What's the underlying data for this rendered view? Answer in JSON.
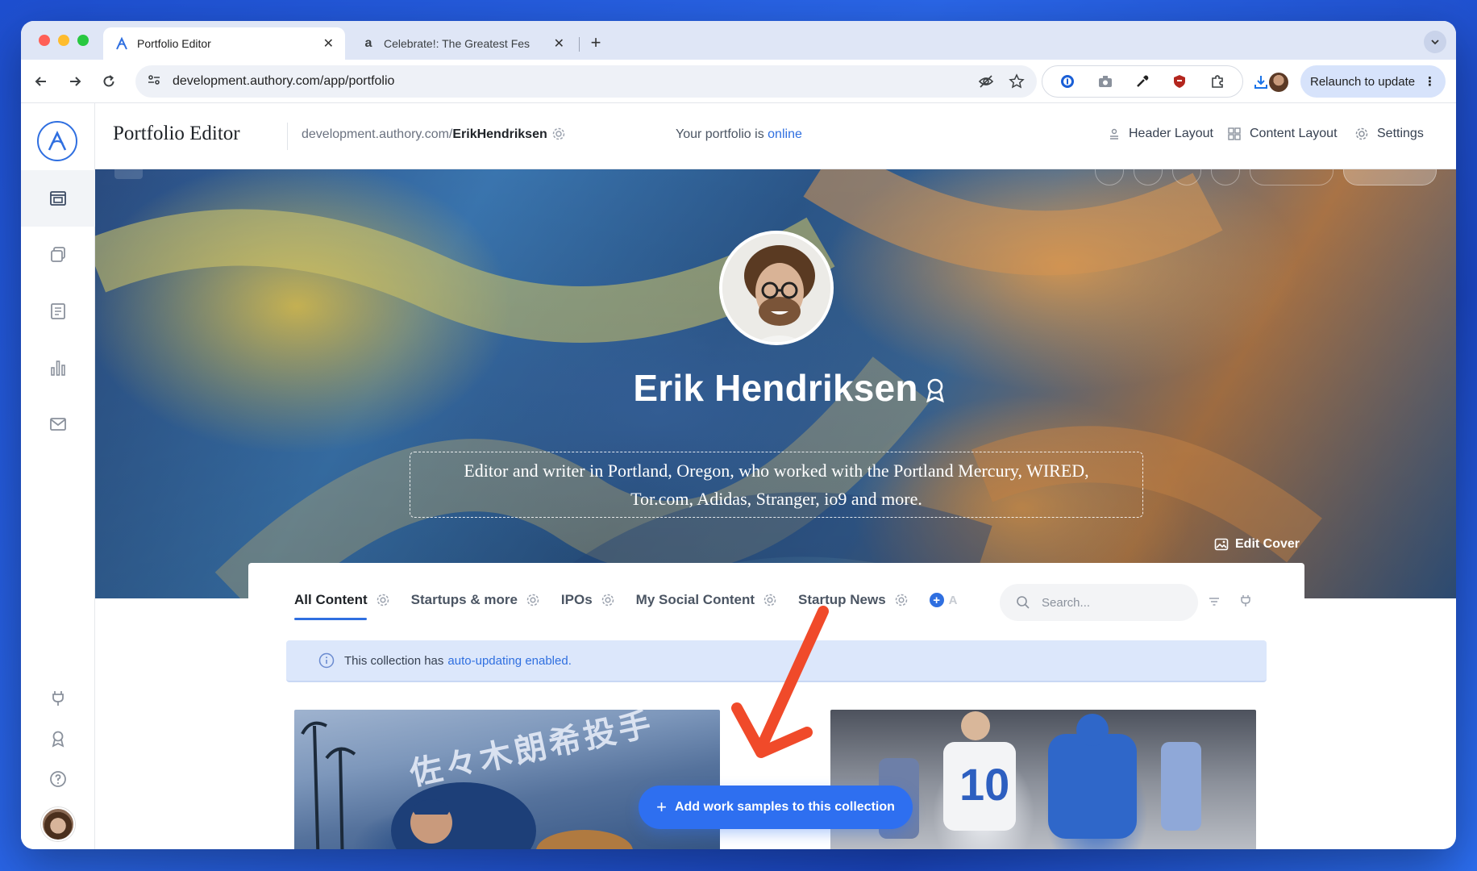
{
  "browser": {
    "tabs": [
      {
        "title": "Portfolio Editor",
        "active": true
      },
      {
        "title": "Celebrate!: The Greatest Fes",
        "active": false
      }
    ],
    "url": "development.authory.com/app/portfolio",
    "relaunch_label": "Relaunch to update"
  },
  "header": {
    "title": "Portfolio Editor",
    "portfolio_url_prefix": "development.authory.com/",
    "portfolio_url_user": "ErikHendriksen",
    "status_prefix": "Your portfolio is",
    "status_value": "online",
    "buttons": {
      "header_layout": "Header Layout",
      "content_layout": "Content Layout",
      "settings": "Settings"
    }
  },
  "profile": {
    "name": "Erik Hendriksen",
    "bio_line1": "Editor and writer in Portland, Oregon, who worked with the Portland Mercury, WIRED,",
    "bio_line2": "Tor.com, Adidas, Stranger, io9 and more.",
    "edit_cover_label": "Edit Cover"
  },
  "collections": {
    "tabs": [
      {
        "label": "All Content",
        "active": true
      },
      {
        "label": "Startups & more",
        "active": false
      },
      {
        "label": "IPOs",
        "active": false
      },
      {
        "label": "My Social Content",
        "active": false
      },
      {
        "label": "Startup News",
        "active": false
      }
    ],
    "add_tab_fade": "A",
    "search_placeholder": "Search..."
  },
  "info_banner": {
    "text": "This collection has",
    "link": "auto-updating enabled."
  },
  "thumbnails": {
    "first_overlay_text": "佐々木朗希投手",
    "second_overlay_text": "10"
  },
  "add_samples_label": "Add work samples to this collection",
  "colors": {
    "accent": "#2f6fe0",
    "annotation_arrow": "#f04a2a",
    "banner_bg": "#dce7fb"
  }
}
